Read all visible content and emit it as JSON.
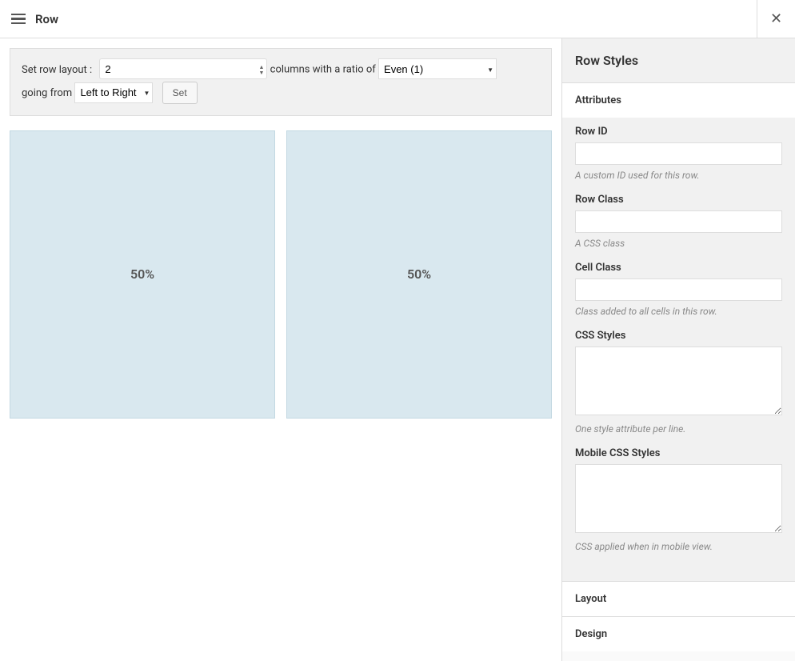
{
  "header": {
    "title": "Row"
  },
  "layout_controls": {
    "label_set": "Set row layout :",
    "columns_value": "2",
    "label_columns_with": "columns with a ratio of",
    "ratio_selected": "Even (1)",
    "label_going_from": "going from",
    "direction_selected": "Left to Right",
    "set_button": "Set"
  },
  "preview": {
    "columns": [
      "50%",
      "50%"
    ]
  },
  "sidebar": {
    "title": "Row Styles",
    "sections": {
      "attributes": {
        "title": "Attributes",
        "fields": {
          "row_id": {
            "label": "Row ID",
            "value": "",
            "hint": "A custom ID used for this row."
          },
          "row_class": {
            "label": "Row Class",
            "value": "",
            "hint": "A CSS class"
          },
          "cell_class": {
            "label": "Cell Class",
            "value": "",
            "hint": "Class added to all cells in this row."
          },
          "css_styles": {
            "label": "CSS Styles",
            "value": "",
            "hint": "One style attribute per line."
          },
          "mobile_css": {
            "label": "Mobile CSS Styles",
            "value": "",
            "hint": "CSS applied when in mobile view."
          }
        }
      },
      "layout": {
        "title": "Layout"
      },
      "design": {
        "title": "Design"
      }
    }
  }
}
